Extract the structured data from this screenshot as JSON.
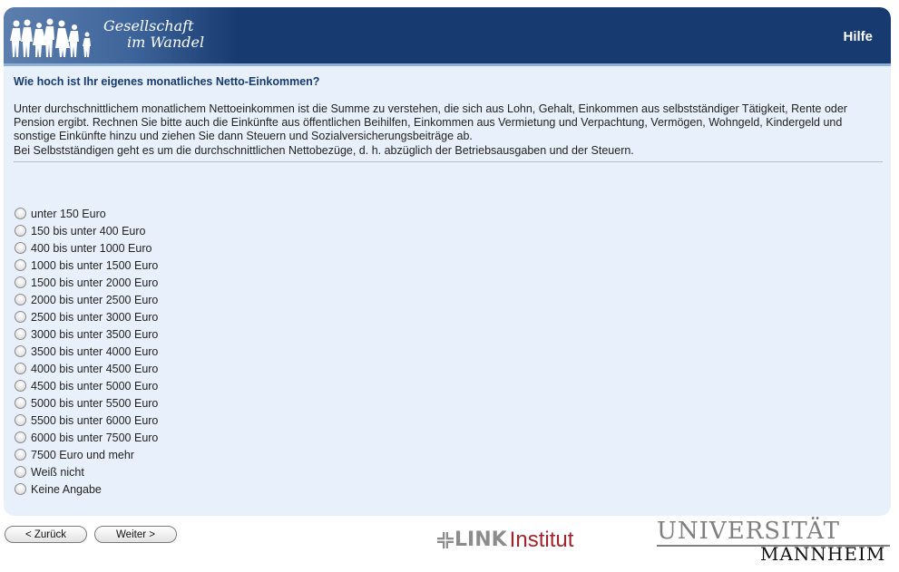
{
  "header": {
    "logo_line1": "Gesellschaft",
    "logo_line2": "im Wandel",
    "help_label": "Hilfe"
  },
  "question": {
    "title": "Wie hoch ist Ihr eigenes monatliches Netto-Einkommen?",
    "description_paragraph1": "Unter durchschnittlichem monatlichem Nettoeinkommen ist die Summe zu verstehen, die sich aus Lohn, Gehalt, Einkommen aus selbstständiger Tätigkeit, Rente oder Pension ergibt. Rechnen Sie bitte auch die Einkünfte aus öffentlichen Beihilfen, Einkommen aus Vermietung und Verpachtung, Vermögen, Wohngeld, Kindergeld und sonstige Einkünfte hinzu und ziehen Sie dann Steuern und Sozialversicherungsbeiträge ab.",
    "description_paragraph2": "Bei Selbstständigen geht es um die durchschnittlichen Nettobezüge, d. h. abzüglich der Betriebsausgaben und der Steuern."
  },
  "options": [
    "unter 150 Euro",
    "150 bis unter 400 Euro",
    "400 bis unter 1000 Euro",
    "1000 bis unter 1500 Euro",
    "1500 bis unter 2000 Euro",
    "2000 bis unter 2500 Euro",
    "2500 bis unter 3000 Euro",
    "3000 bis unter 3500 Euro",
    "3500 bis unter 4000 Euro",
    "4000 bis unter 4500 Euro",
    "4500 bis unter 5000 Euro",
    "5000 bis unter 5500 Euro",
    "5500 bis unter 6000 Euro",
    "6000 bis unter 7500 Euro",
    "7500 Euro und mehr",
    "Weiß nicht",
    "Keine Angabe"
  ],
  "navigation": {
    "back_label": "< Zurück",
    "next_label": "Weiter >"
  },
  "footer": {
    "link_word": "LINK",
    "institut_word": "Institut",
    "university_word": "UNIVERSITÄT",
    "city_word": "MANNHEIM"
  },
  "colors": {
    "header_blue": "#173a70",
    "panel_background": "#e8f1fb",
    "institut_red": "#a0242c"
  }
}
